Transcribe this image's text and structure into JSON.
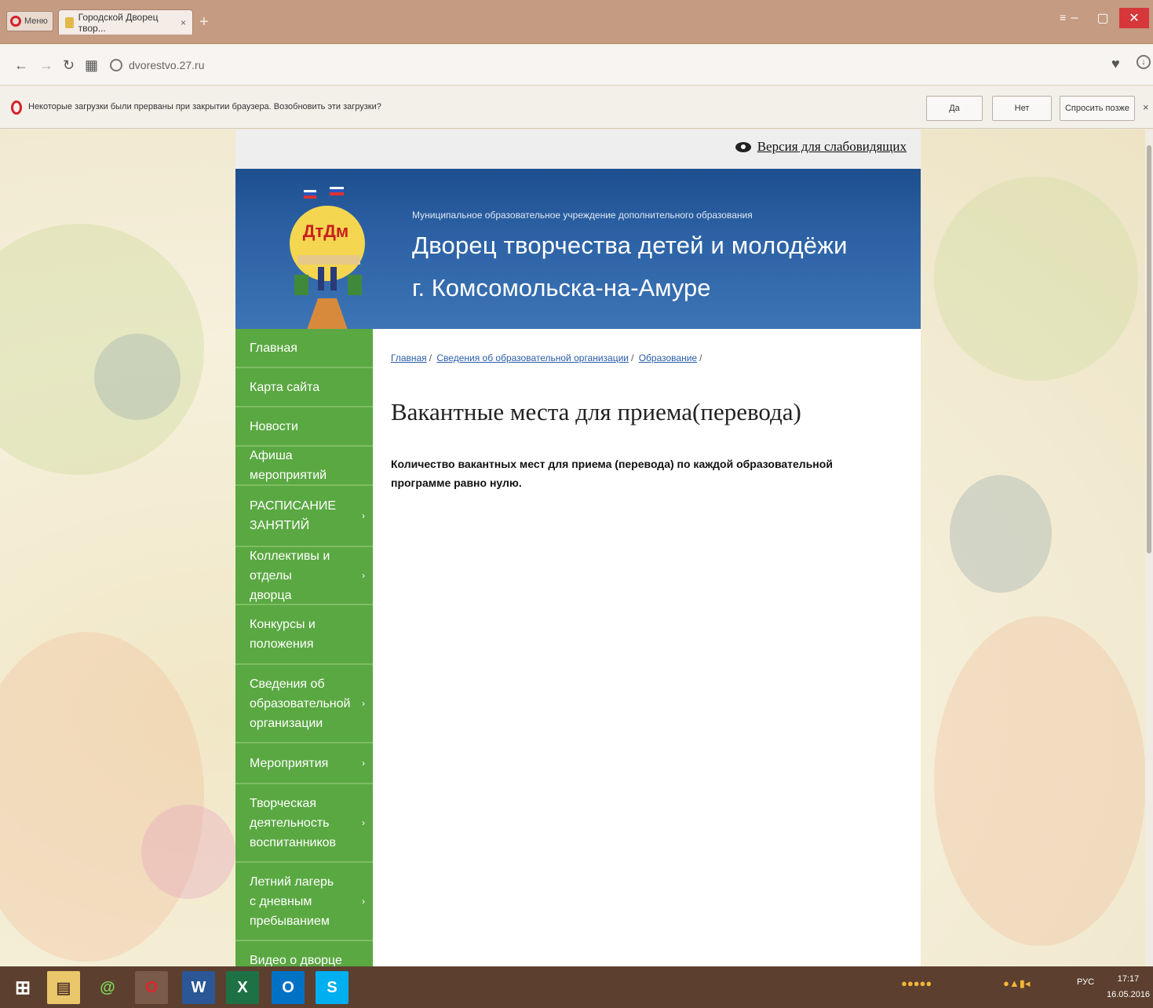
{
  "browser": {
    "menu_label": "Меню",
    "tab_title": "Городской Дворец твор...",
    "tab_close": "×",
    "new_tab": "+",
    "url": "dvorestvo.27.ru",
    "infobar": {
      "message": "Некоторые загрузки были прерваны при закрытии браузера. Возобновить эти загрузки?",
      "yes": "Да",
      "no": "Нет",
      "later": "Спросить позже",
      "close": "×"
    }
  },
  "site": {
    "vision_link": "Версия для слабовидящих",
    "header": {
      "subtitle": "Муниципальное образовательное учреждение дополнительного образования",
      "title_line1": "Дворец творчества детей и молодёжи",
      "title_line2": "г. Комсомольска-на-Амуре",
      "logo_text": "ДтДм"
    },
    "nav": [
      {
        "label": "Главная",
        "has_sub": false
      },
      {
        "label": "Карта сайта",
        "has_sub": false
      },
      {
        "label": "Новости",
        "has_sub": false
      },
      {
        "label": "Афиша мероприятий",
        "has_sub": false
      },
      {
        "label": "РАСПИСАНИЕ ЗАНЯТИЙ",
        "has_sub": true
      },
      {
        "label": "Коллективы и отделы дворца",
        "has_sub": true
      },
      {
        "label": "Конкурсы и положения",
        "has_sub": false
      },
      {
        "label": "Сведения об образовательной организации",
        "has_sub": true
      },
      {
        "label": "Мероприятия",
        "has_sub": true
      },
      {
        "label": "Творческая деятельность воспитанников",
        "has_sub": true
      },
      {
        "label": "Летний лагерь с дневным пребыванием",
        "has_sub": true
      },
      {
        "label": "Видео о дворце",
        "has_sub": false
      }
    ],
    "breadcrumbs": [
      "Главная",
      "Сведения об образовательной организации",
      "Образование"
    ],
    "page_title": "Вакантные места для приема(перевода)",
    "body_text": "Количество вакантных мест для приема (перевода) по каждой образовательной программе равно нулю."
  },
  "taskbar": {
    "lang": "РУС",
    "time": "17:17",
    "date": "16.05.2016"
  },
  "colors": {
    "header_blue": "#2d63a6",
    "nav_green": "#5aa842",
    "link_blue": "#2a5ca8",
    "tabbar": "#c59b82",
    "taskbar": "#5c3f2f"
  }
}
